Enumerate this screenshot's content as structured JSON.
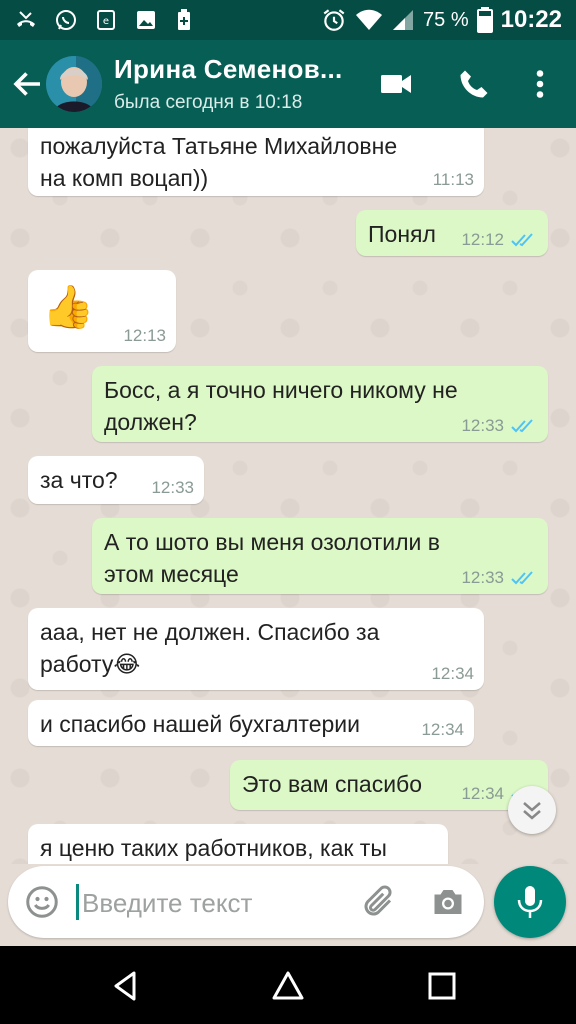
{
  "status_bar": {
    "battery_percent": "75 %",
    "time": "10:22"
  },
  "header": {
    "contact_name": "Ирина Семенов...",
    "last_seen": "была сегодня в 10:18"
  },
  "messages": [
    {
      "direction": "in",
      "text_lines": [
        "пожалуйста Татьяне Михайловне",
        "на комп воцап))"
      ],
      "time": "11:13"
    },
    {
      "direction": "out",
      "text_lines": [
        "Понял"
      ],
      "time": "12:12",
      "read": true
    },
    {
      "direction": "in",
      "text_lines": [
        "👍"
      ],
      "time": "12:13"
    },
    {
      "direction": "out",
      "text_lines": [
        "Босс, а я точно ничего никому не",
        "должен?"
      ],
      "time": "12:33",
      "read": true
    },
    {
      "direction": "in",
      "text_lines": [
        "за что?"
      ],
      "time": "12:33"
    },
    {
      "direction": "out",
      "text_lines": [
        "А то шото вы меня озолотили в",
        "этом месяце"
      ],
      "time": "12:33",
      "read": true
    },
    {
      "direction": "in",
      "text_lines": [
        "ааа, нет не должен. Спасибо за",
        "работу😂"
      ],
      "time": "12:34"
    },
    {
      "direction": "in",
      "text_lines": [
        "и спасибо нашей бухгалтерии"
      ],
      "time": "12:34"
    },
    {
      "direction": "out",
      "text_lines": [
        "Это вам спасибо"
      ],
      "time": "12:34",
      "read": true
    },
    {
      "direction": "in",
      "text_lines": [
        "я ценю таких работников, как ты"
      ],
      "time": ""
    }
  ],
  "input": {
    "placeholder": "Введите текст"
  },
  "colors": {
    "header": "#075e54",
    "status_bar": "#054d44",
    "outgoing_bubble": "#dcf8c6",
    "incoming_bubble": "#ffffff",
    "read_ticks": "#4fc3f7",
    "mic_button": "#00897b"
  },
  "icons": {
    "back": "arrow-left-icon",
    "video_call": "video-camera-icon",
    "voice_call": "phone-icon",
    "menu": "more-vertical-icon",
    "scroll_down": "double-chevron-down-icon",
    "emoji": "smiley-icon",
    "attach": "paperclip-icon",
    "camera": "camera-icon",
    "mic": "microphone-icon"
  }
}
